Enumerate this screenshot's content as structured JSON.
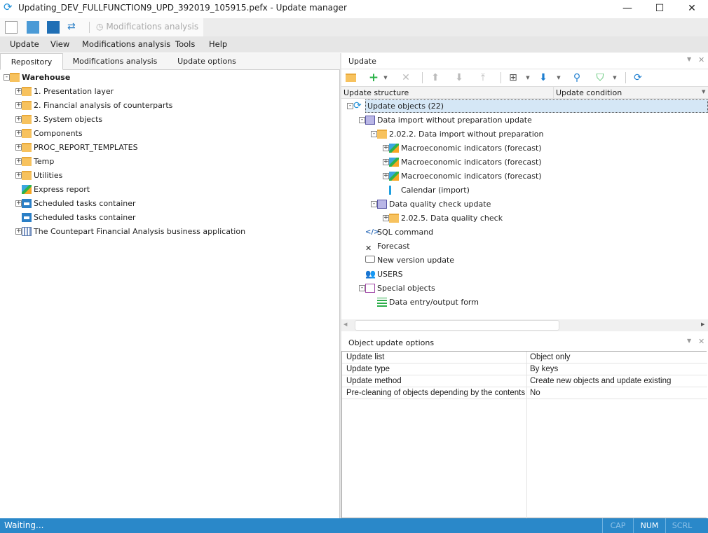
{
  "window": {
    "title": "Updating_DEV_FULLFUNCTION9_UPD_392019_105915.pefx - Update manager"
  },
  "qat": {
    "modifications_analysis": "Modifications analysis"
  },
  "menu": [
    "Update",
    "View",
    "Modifications analysis",
    "Tools",
    "Help"
  ],
  "tabs": [
    "Repository",
    "Modifications analysis",
    "Update options"
  ],
  "repository_tree": [
    {
      "label": "Warehouse",
      "level": 0,
      "exp": "-",
      "icon": "folder",
      "bold": true
    },
    {
      "label": "1. Presentation layer",
      "level": 1,
      "exp": "+",
      "icon": "folder"
    },
    {
      "label": "2. Financial analysis of counterparts",
      "level": 1,
      "exp": "+",
      "icon": "folder"
    },
    {
      "label": "3. System objects",
      "level": 1,
      "exp": "+",
      "icon": "folder"
    },
    {
      "label": "Components",
      "level": 1,
      "exp": "+",
      "icon": "folder"
    },
    {
      "label": "PROC_REPORT_TEMPLATES",
      "level": 1,
      "exp": "+",
      "icon": "folder"
    },
    {
      "label": "Temp",
      "level": 1,
      "exp": "+",
      "icon": "folder"
    },
    {
      "label": "Utilities",
      "level": 1,
      "exp": "+",
      "icon": "folder"
    },
    {
      "label": "Express report",
      "level": 1,
      "exp": "",
      "icon": "cube"
    },
    {
      "label": "Scheduled tasks container",
      "level": 1,
      "exp": "+",
      "icon": "sched"
    },
    {
      "label": "Scheduled tasks container",
      "level": 1,
      "exp": "",
      "icon": "sched"
    },
    {
      "label": "The Countepart Financial Analysis business application",
      "level": 1,
      "exp": "+",
      "icon": "chart"
    }
  ],
  "update_panel": {
    "title": "Update",
    "columns": [
      "Update structure",
      "Update condition"
    ],
    "tree": [
      {
        "label": "Update objects (22)",
        "level": 0,
        "exp": "-",
        "icon": "upd",
        "selected": true
      },
      {
        "label": "Data import without preparation update",
        "level": 1,
        "exp": "-",
        "icon": "proc"
      },
      {
        "label": "2.02.2. Data import without preparation",
        "level": 2,
        "exp": "-",
        "icon": "folder"
      },
      {
        "label": "Macroeconomic indicators (forecast)",
        "level": 3,
        "exp": "+",
        "icon": "cube"
      },
      {
        "label": "Macroeconomic indicators (forecast)",
        "level": 3,
        "exp": "+",
        "icon": "cube"
      },
      {
        "label": "Macroeconomic indicators (forecast)",
        "level": 3,
        "exp": "+",
        "icon": "cube"
      },
      {
        "label": "Calendar (import)",
        "level": 3,
        "exp": "",
        "icon": "cal"
      },
      {
        "label": "Data quality check update",
        "level": 2,
        "exp": "-",
        "icon": "proc"
      },
      {
        "label": "2.02.5. Data quality check",
        "level": 3,
        "exp": "+",
        "icon": "folder"
      },
      {
        "label": "SQL command",
        "level": 1,
        "exp": "",
        "icon": "sql"
      },
      {
        "label": "Forecast",
        "level": 1,
        "exp": "",
        "icon": "x"
      },
      {
        "label": "New version update",
        "level": 1,
        "exp": "",
        "icon": "bubble"
      },
      {
        "label": "USERS",
        "level": 1,
        "exp": "",
        "icon": "users"
      },
      {
        "label": "Special objects",
        "level": 1,
        "exp": "-",
        "icon": "doc"
      },
      {
        "label": "Data entry/output form",
        "level": 2,
        "exp": "",
        "icon": "form"
      }
    ]
  },
  "options_panel": {
    "title": "Object update options",
    "rows": [
      {
        "key": "Update list",
        "value": "Object only"
      },
      {
        "key": "Update type",
        "value": "By keys"
      },
      {
        "key": "Update method",
        "value": "Create new objects and update existing"
      },
      {
        "key": "Pre-cleaning of objects depending by the contents",
        "value": "No"
      }
    ]
  },
  "status": {
    "text": "Waiting...",
    "cap": "CAP",
    "num": "NUM",
    "scrl": "SCRL"
  },
  "colors": {
    "status_bar": "#2a88c9",
    "selection": "#d5e7f6"
  }
}
